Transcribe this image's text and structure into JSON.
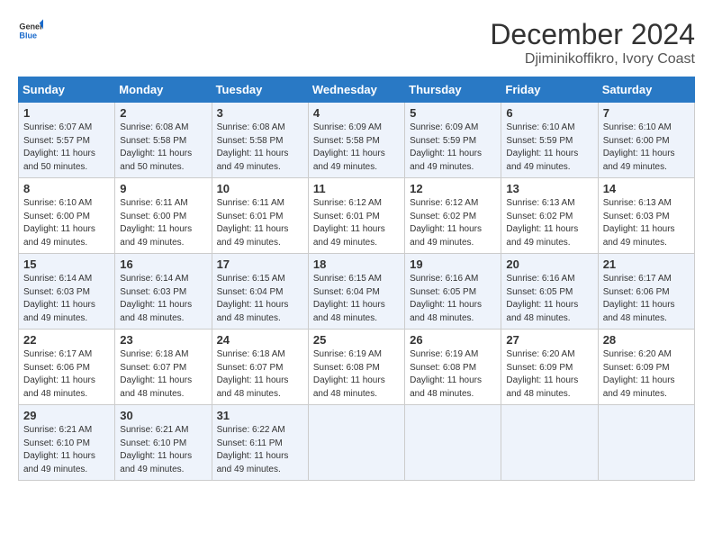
{
  "header": {
    "logo_line1": "General",
    "logo_line2": "Blue",
    "month": "December 2024",
    "location": "Djiminikoffikro, Ivory Coast"
  },
  "weekdays": [
    "Sunday",
    "Monday",
    "Tuesday",
    "Wednesday",
    "Thursday",
    "Friday",
    "Saturday"
  ],
  "weeks": [
    [
      {
        "day": "1",
        "sunrise": "Sunrise: 6:07 AM",
        "sunset": "Sunset: 5:57 PM",
        "daylight": "Daylight: 11 hours and 50 minutes."
      },
      {
        "day": "2",
        "sunrise": "Sunrise: 6:08 AM",
        "sunset": "Sunset: 5:58 PM",
        "daylight": "Daylight: 11 hours and 50 minutes."
      },
      {
        "day": "3",
        "sunrise": "Sunrise: 6:08 AM",
        "sunset": "Sunset: 5:58 PM",
        "daylight": "Daylight: 11 hours and 49 minutes."
      },
      {
        "day": "4",
        "sunrise": "Sunrise: 6:09 AM",
        "sunset": "Sunset: 5:58 PM",
        "daylight": "Daylight: 11 hours and 49 minutes."
      },
      {
        "day": "5",
        "sunrise": "Sunrise: 6:09 AM",
        "sunset": "Sunset: 5:59 PM",
        "daylight": "Daylight: 11 hours and 49 minutes."
      },
      {
        "day": "6",
        "sunrise": "Sunrise: 6:10 AM",
        "sunset": "Sunset: 5:59 PM",
        "daylight": "Daylight: 11 hours and 49 minutes."
      },
      {
        "day": "7",
        "sunrise": "Sunrise: 6:10 AM",
        "sunset": "Sunset: 6:00 PM",
        "daylight": "Daylight: 11 hours and 49 minutes."
      }
    ],
    [
      {
        "day": "8",
        "sunrise": "Sunrise: 6:10 AM",
        "sunset": "Sunset: 6:00 PM",
        "daylight": "Daylight: 11 hours and 49 minutes."
      },
      {
        "day": "9",
        "sunrise": "Sunrise: 6:11 AM",
        "sunset": "Sunset: 6:00 PM",
        "daylight": "Daylight: 11 hours and 49 minutes."
      },
      {
        "day": "10",
        "sunrise": "Sunrise: 6:11 AM",
        "sunset": "Sunset: 6:01 PM",
        "daylight": "Daylight: 11 hours and 49 minutes."
      },
      {
        "day": "11",
        "sunrise": "Sunrise: 6:12 AM",
        "sunset": "Sunset: 6:01 PM",
        "daylight": "Daylight: 11 hours and 49 minutes."
      },
      {
        "day": "12",
        "sunrise": "Sunrise: 6:12 AM",
        "sunset": "Sunset: 6:02 PM",
        "daylight": "Daylight: 11 hours and 49 minutes."
      },
      {
        "day": "13",
        "sunrise": "Sunrise: 6:13 AM",
        "sunset": "Sunset: 6:02 PM",
        "daylight": "Daylight: 11 hours and 49 minutes."
      },
      {
        "day": "14",
        "sunrise": "Sunrise: 6:13 AM",
        "sunset": "Sunset: 6:03 PM",
        "daylight": "Daylight: 11 hours and 49 minutes."
      }
    ],
    [
      {
        "day": "15",
        "sunrise": "Sunrise: 6:14 AM",
        "sunset": "Sunset: 6:03 PM",
        "daylight": "Daylight: 11 hours and 49 minutes."
      },
      {
        "day": "16",
        "sunrise": "Sunrise: 6:14 AM",
        "sunset": "Sunset: 6:03 PM",
        "daylight": "Daylight: 11 hours and 48 minutes."
      },
      {
        "day": "17",
        "sunrise": "Sunrise: 6:15 AM",
        "sunset": "Sunset: 6:04 PM",
        "daylight": "Daylight: 11 hours and 48 minutes."
      },
      {
        "day": "18",
        "sunrise": "Sunrise: 6:15 AM",
        "sunset": "Sunset: 6:04 PM",
        "daylight": "Daylight: 11 hours and 48 minutes."
      },
      {
        "day": "19",
        "sunrise": "Sunrise: 6:16 AM",
        "sunset": "Sunset: 6:05 PM",
        "daylight": "Daylight: 11 hours and 48 minutes."
      },
      {
        "day": "20",
        "sunrise": "Sunrise: 6:16 AM",
        "sunset": "Sunset: 6:05 PM",
        "daylight": "Daylight: 11 hours and 48 minutes."
      },
      {
        "day": "21",
        "sunrise": "Sunrise: 6:17 AM",
        "sunset": "Sunset: 6:06 PM",
        "daylight": "Daylight: 11 hours and 48 minutes."
      }
    ],
    [
      {
        "day": "22",
        "sunrise": "Sunrise: 6:17 AM",
        "sunset": "Sunset: 6:06 PM",
        "daylight": "Daylight: 11 hours and 48 minutes."
      },
      {
        "day": "23",
        "sunrise": "Sunrise: 6:18 AM",
        "sunset": "Sunset: 6:07 PM",
        "daylight": "Daylight: 11 hours and 48 minutes."
      },
      {
        "day": "24",
        "sunrise": "Sunrise: 6:18 AM",
        "sunset": "Sunset: 6:07 PM",
        "daylight": "Daylight: 11 hours and 48 minutes."
      },
      {
        "day": "25",
        "sunrise": "Sunrise: 6:19 AM",
        "sunset": "Sunset: 6:08 PM",
        "daylight": "Daylight: 11 hours and 48 minutes."
      },
      {
        "day": "26",
        "sunrise": "Sunrise: 6:19 AM",
        "sunset": "Sunset: 6:08 PM",
        "daylight": "Daylight: 11 hours and 48 minutes."
      },
      {
        "day": "27",
        "sunrise": "Sunrise: 6:20 AM",
        "sunset": "Sunset: 6:09 PM",
        "daylight": "Daylight: 11 hours and 48 minutes."
      },
      {
        "day": "28",
        "sunrise": "Sunrise: 6:20 AM",
        "sunset": "Sunset: 6:09 PM",
        "daylight": "Daylight: 11 hours and 49 minutes."
      }
    ],
    [
      {
        "day": "29",
        "sunrise": "Sunrise: 6:21 AM",
        "sunset": "Sunset: 6:10 PM",
        "daylight": "Daylight: 11 hours and 49 minutes."
      },
      {
        "day": "30",
        "sunrise": "Sunrise: 6:21 AM",
        "sunset": "Sunset: 6:10 PM",
        "daylight": "Daylight: 11 hours and 49 minutes."
      },
      {
        "day": "31",
        "sunrise": "Sunrise: 6:22 AM",
        "sunset": "Sunset: 6:11 PM",
        "daylight": "Daylight: 11 hours and 49 minutes."
      },
      null,
      null,
      null,
      null
    ]
  ]
}
